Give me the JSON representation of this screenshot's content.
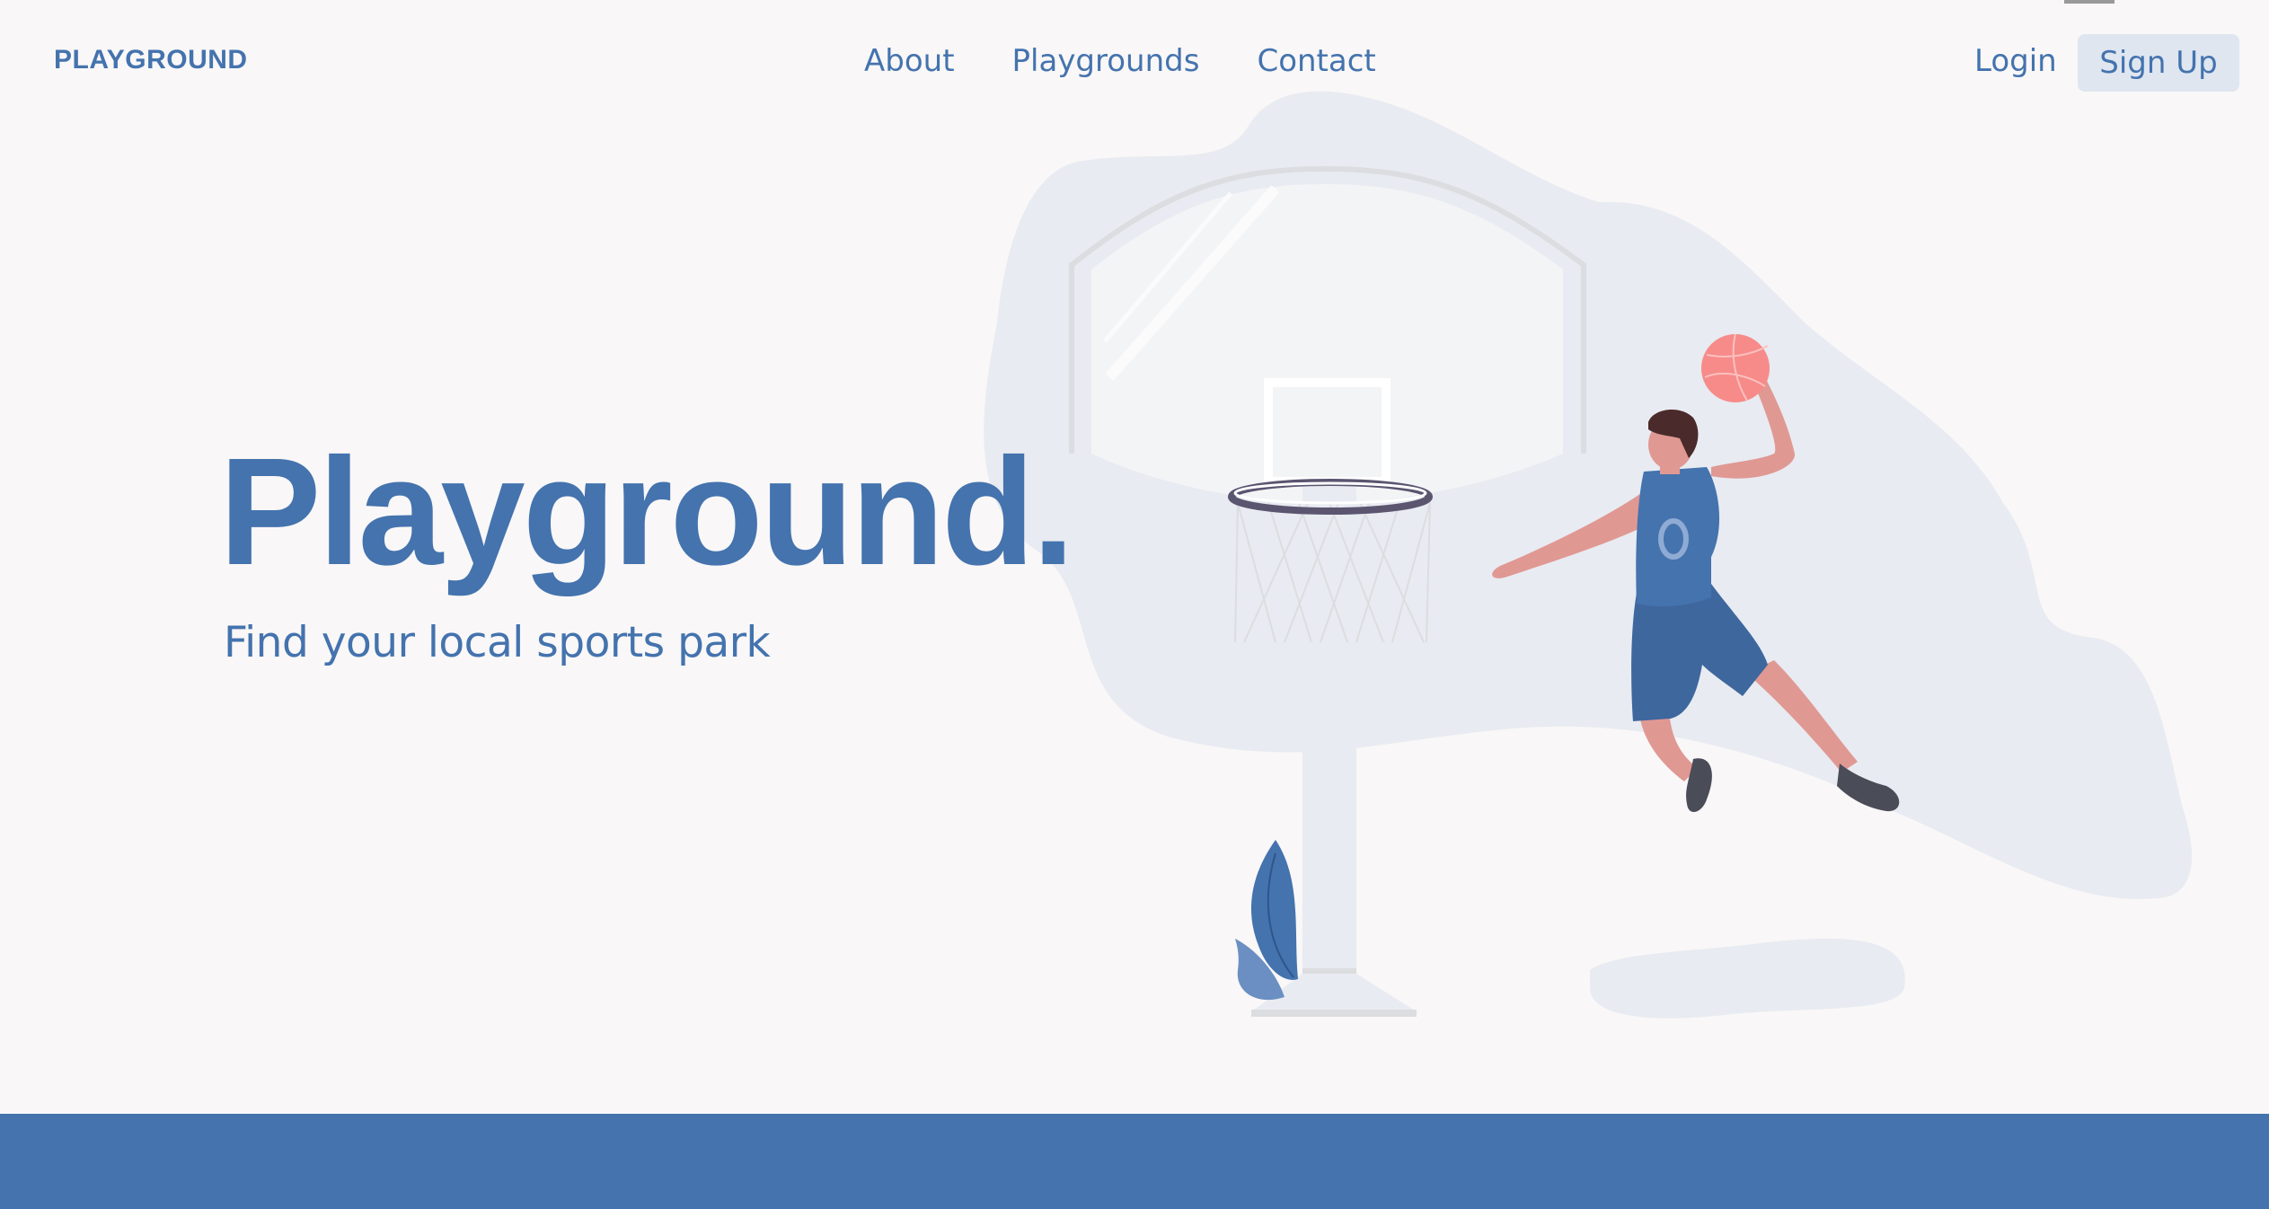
{
  "header": {
    "logo": "PLAYGROUND",
    "nav": [
      "About",
      "Playgrounds",
      "Contact"
    ],
    "login": "Login",
    "signup": "Sign Up"
  },
  "hero": {
    "title": "Playground.",
    "subtitle": "Find your local sports park"
  },
  "colors": {
    "primary": "#4473ae",
    "background": "#f9f7f7",
    "blob": "#e8ebf1",
    "ball": "#f68b89",
    "skin": "#e09893"
  },
  "illustration": {
    "icons": [
      "basketball-hoop-icon",
      "basketball-player-icon",
      "basketball-icon",
      "plant-icon"
    ]
  }
}
